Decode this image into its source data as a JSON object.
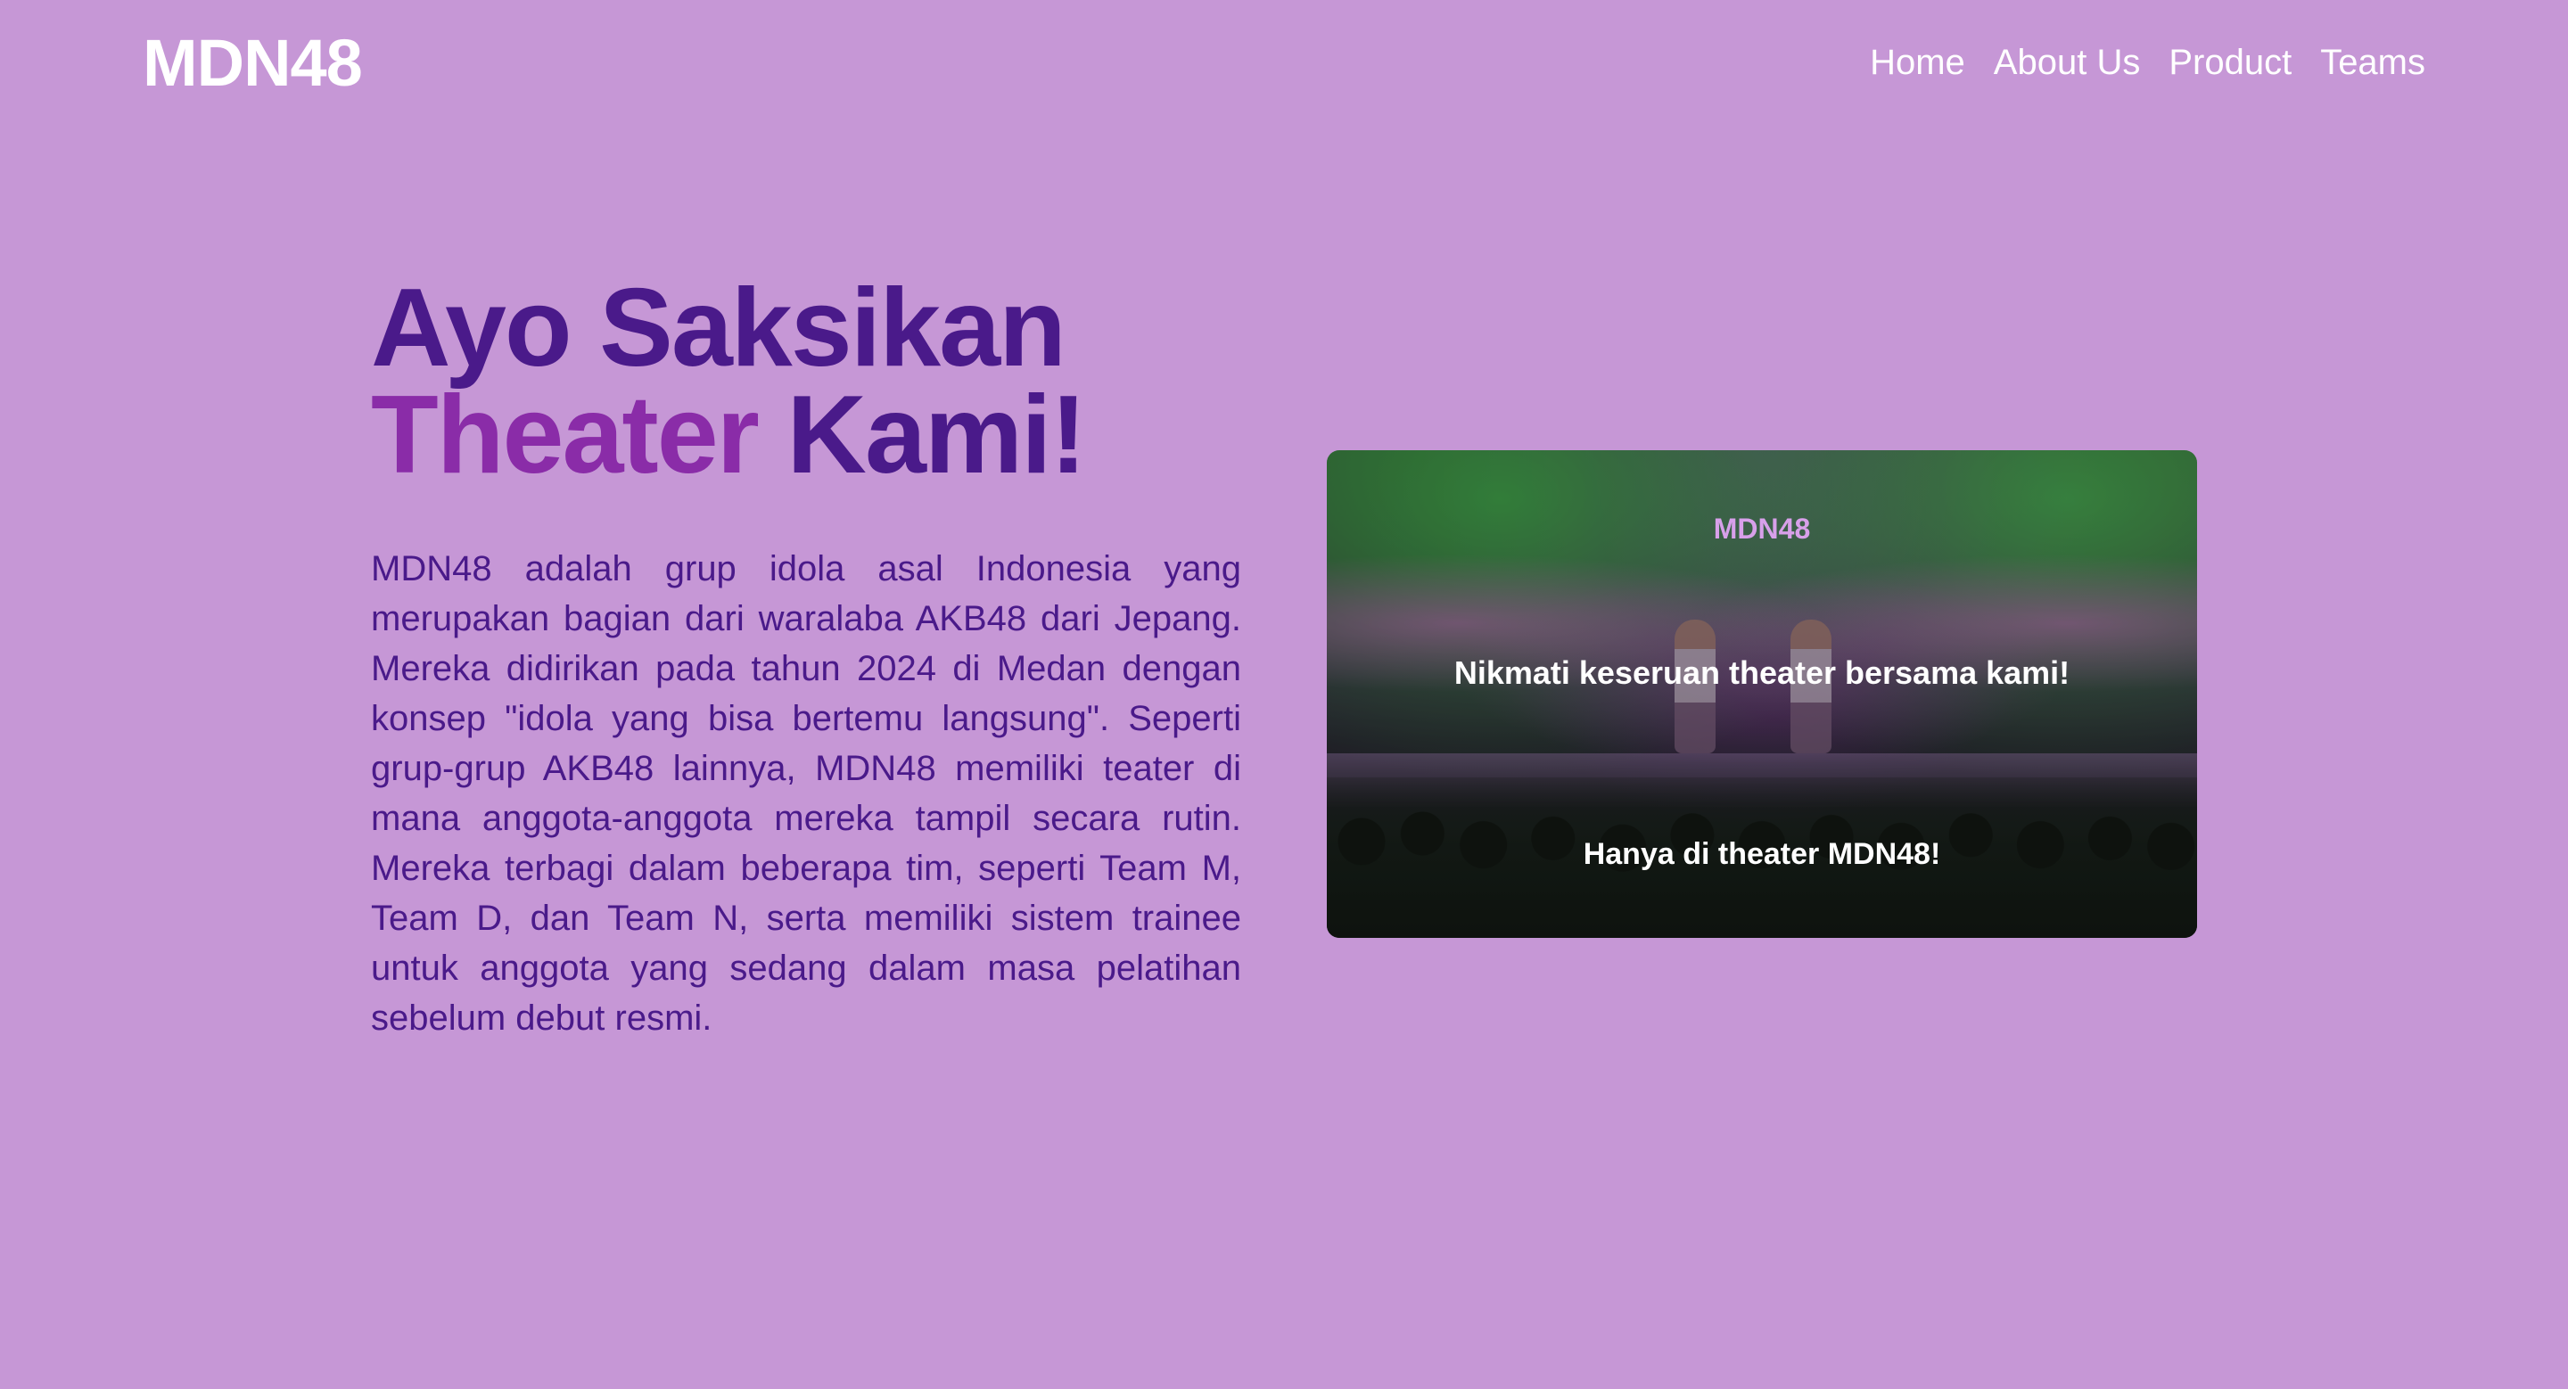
{
  "header": {
    "logo": "MDN48",
    "nav": [
      "Home",
      "About Us",
      "Product",
      "Teams"
    ]
  },
  "hero": {
    "title_line1": "Ayo Saksikan",
    "title_accent": "Theater",
    "title_rest": "Kami!",
    "description": "MDN48 adalah grup idola asal Indonesia yang merupakan bagian dari waralaba AKB48 dari Jepang. Mereka didirikan pada tahun 2024 di Medan dengan konsep \"idola yang bisa bertemu langsung\". Seperti grup-grup AKB48 lainnya, MDN48 memiliki teater di mana anggota-anggota mereka tampil secara rutin. Mereka terbagi dalam beberapa tim, seperti Team M, Team D, dan Team N, serta memiliki sistem trainee untuk anggota yang sedang dalam masa pelatihan sebelum debut resmi."
  },
  "banner": {
    "brand": "MDN48",
    "headline": "Nikmati keseruan theater bersama kami!",
    "subline": "Hanya di theater MDN48!"
  },
  "colors": {
    "background": "#c697d6",
    "title_dark": "#4a1a8a",
    "title_accent": "#8a2ca8",
    "nav_text": "#ffffff"
  }
}
